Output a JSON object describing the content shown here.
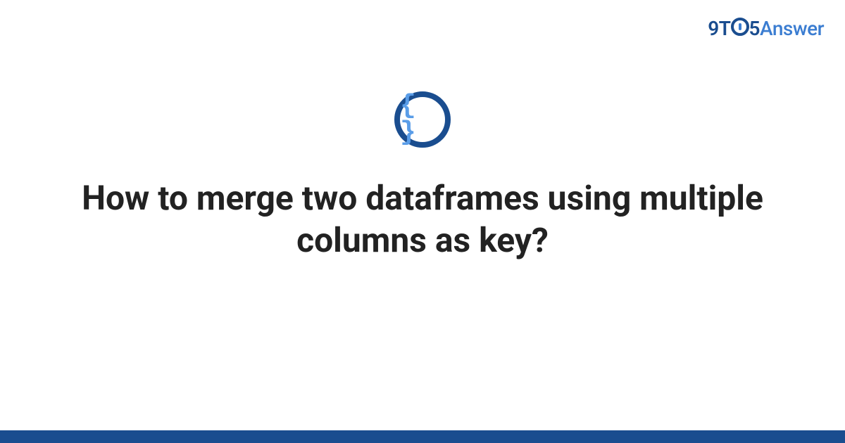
{
  "logo": {
    "nine": "9",
    "t": "T",
    "five": "5",
    "answer": "Answer"
  },
  "icon": {
    "braces": "{ }"
  },
  "title": "How to merge two dataframes using multiple columns as key?",
  "colors": {
    "primary": "#1a4d8f",
    "secondary": "#3b7dd1",
    "icon_braces": "#5a9de8"
  }
}
